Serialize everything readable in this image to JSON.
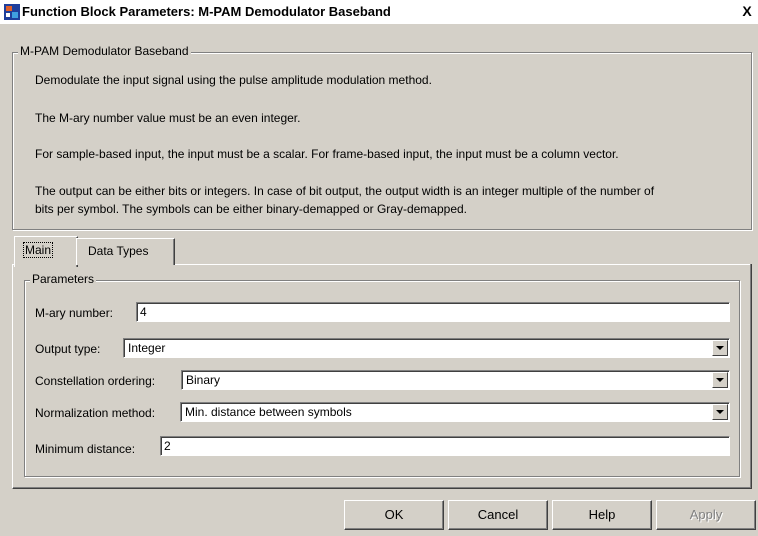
{
  "window": {
    "title": "Function Block Parameters: M-PAM Demodulator Baseband",
    "close_glyph": "X"
  },
  "block": {
    "group_title": "M-PAM Demodulator Baseband",
    "description": [
      "Demodulate the input signal using the pulse amplitude modulation method.",
      "The M-ary number value must be an even integer.",
      "For sample-based input, the input must be a scalar. For frame-based input, the input must be a column vector.",
      "The output can be either bits or integers. In case of bit output, the output width is an integer multiple of the number of",
      "bits per symbol. The symbols can be either binary-demapped or Gray-demapped."
    ]
  },
  "tabs": [
    {
      "label": "Main",
      "active": true
    },
    {
      "label": "Data Types",
      "active": false
    }
  ],
  "parameters": {
    "group_title": "Parameters",
    "mary_number": {
      "label": "M-ary number:",
      "value": "4"
    },
    "output_type": {
      "label": "Output type:",
      "value": "Integer"
    },
    "constellation_ordering": {
      "label": "Constellation ordering:",
      "value": "Binary"
    },
    "normalization_method": {
      "label": "Normalization method:",
      "value": "Min. distance between symbols"
    },
    "minimum_distance": {
      "label": "Minimum distance:",
      "value": "2"
    }
  },
  "buttons": {
    "ok": "OK",
    "cancel": "Cancel",
    "help": "Help",
    "apply": "Apply",
    "apply_enabled": false
  }
}
